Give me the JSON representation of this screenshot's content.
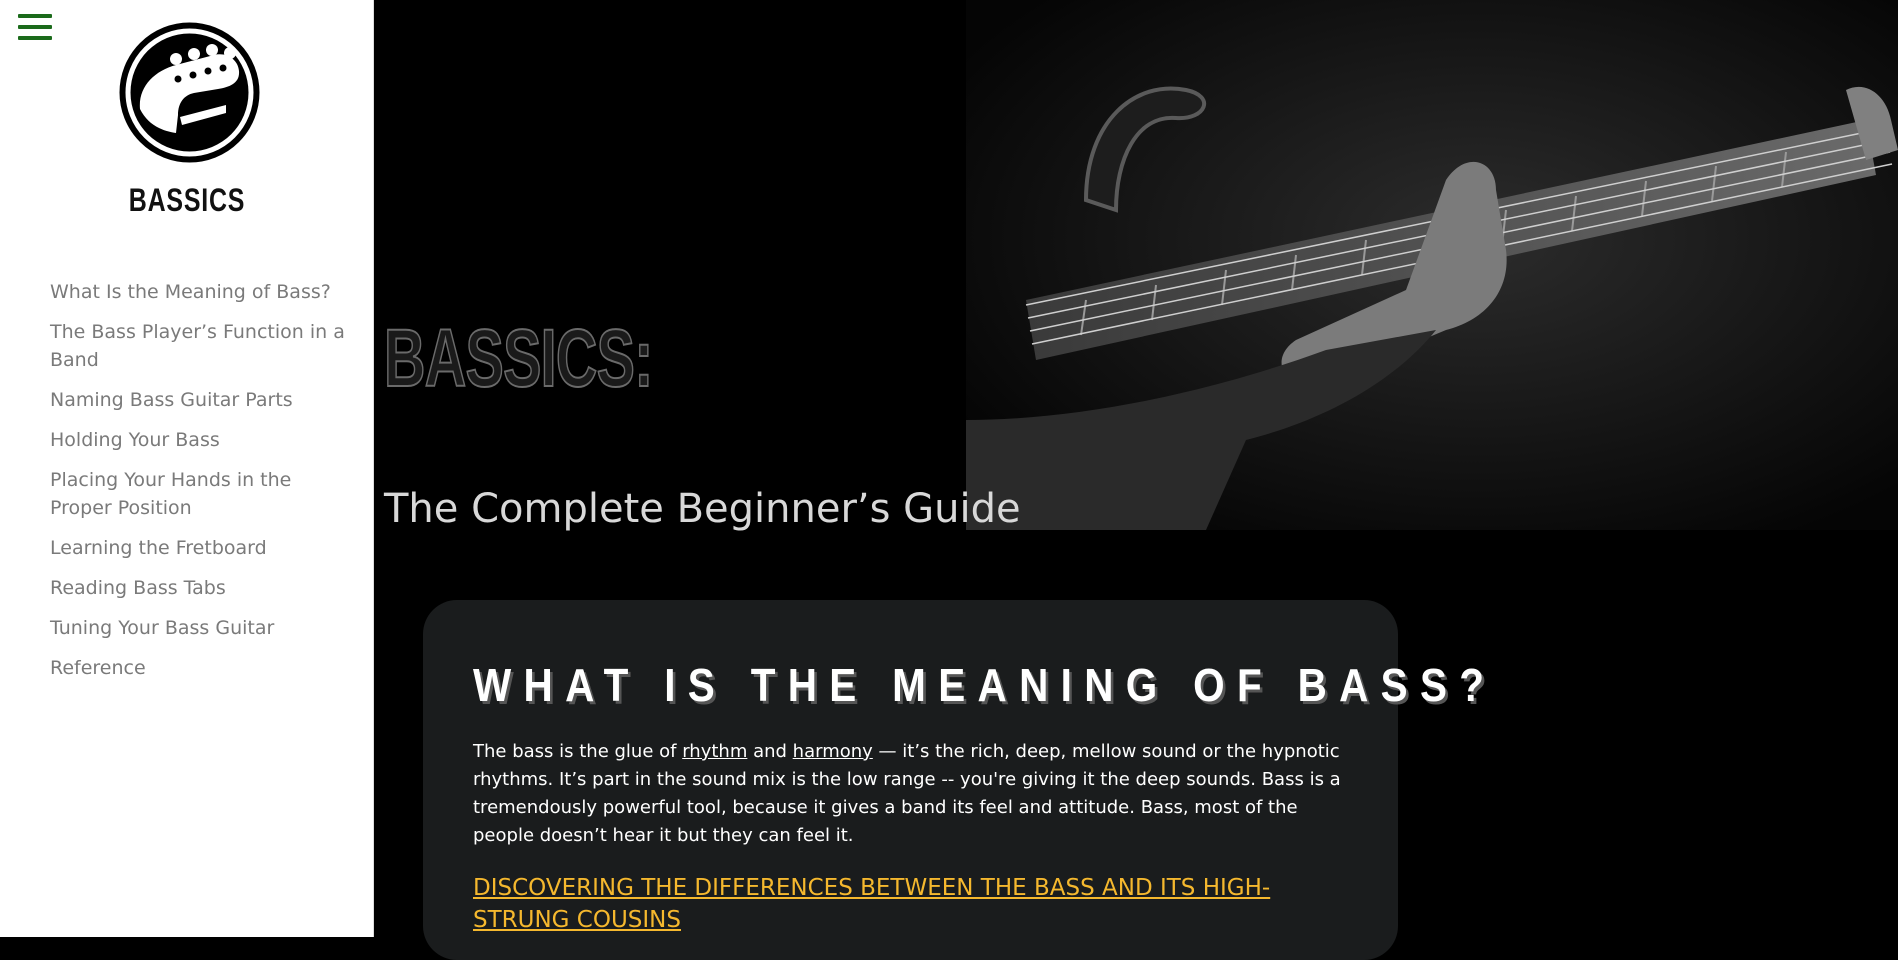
{
  "sidebar": {
    "brand": "BASSICS",
    "nav_items": [
      {
        "label": "What Is the Meaning of Bass?"
      },
      {
        "label": "The Bass Player’s Function in a Band"
      },
      {
        "label": "Naming Bass Guitar Parts"
      },
      {
        "label": "Holding Your Bass"
      },
      {
        "label": "Placing Your Hands in the Proper Position"
      },
      {
        "label": "Learning the Fretboard"
      },
      {
        "label": "Reading Bass Tabs"
      },
      {
        "label": "Tuning Your Bass Guitar"
      },
      {
        "label": "Reference"
      }
    ]
  },
  "hero": {
    "title": "BASSICS:",
    "subtitle": "The Complete Beginner’s Guide"
  },
  "section": {
    "heading": "WHAT IS THE MEANING OF BASS?",
    "body_part1": "The bass is the glue of ",
    "link_rhythm": "rhythm",
    "body_part2": " and ",
    "link_harmony": "harmony",
    "body_part3": " — it’s the rich, deep, mellow sound or the hypnotic rhythms. It’s part in the sound mix is the low range -- you're giving it the deep sounds. Bass is a tremendously powerful tool, because it gives a band its feel and attitude. Bass, most of the people doesn’t hear it but they can feel it.",
    "subheading_link": "DISCOVERING THE DIFFERENCES BETWEEN THE BASS AND ITS HIGH-STRUNG COUSINS"
  },
  "colors": {
    "menu_icon": "#1b6b1b",
    "nav_text": "#7a7a7a",
    "card_background": "#1a1c1d",
    "accent_link": "#f5b82e"
  },
  "icons": {
    "menu": "hamburger-menu-icon",
    "logo": "bass-headstock-logo"
  }
}
